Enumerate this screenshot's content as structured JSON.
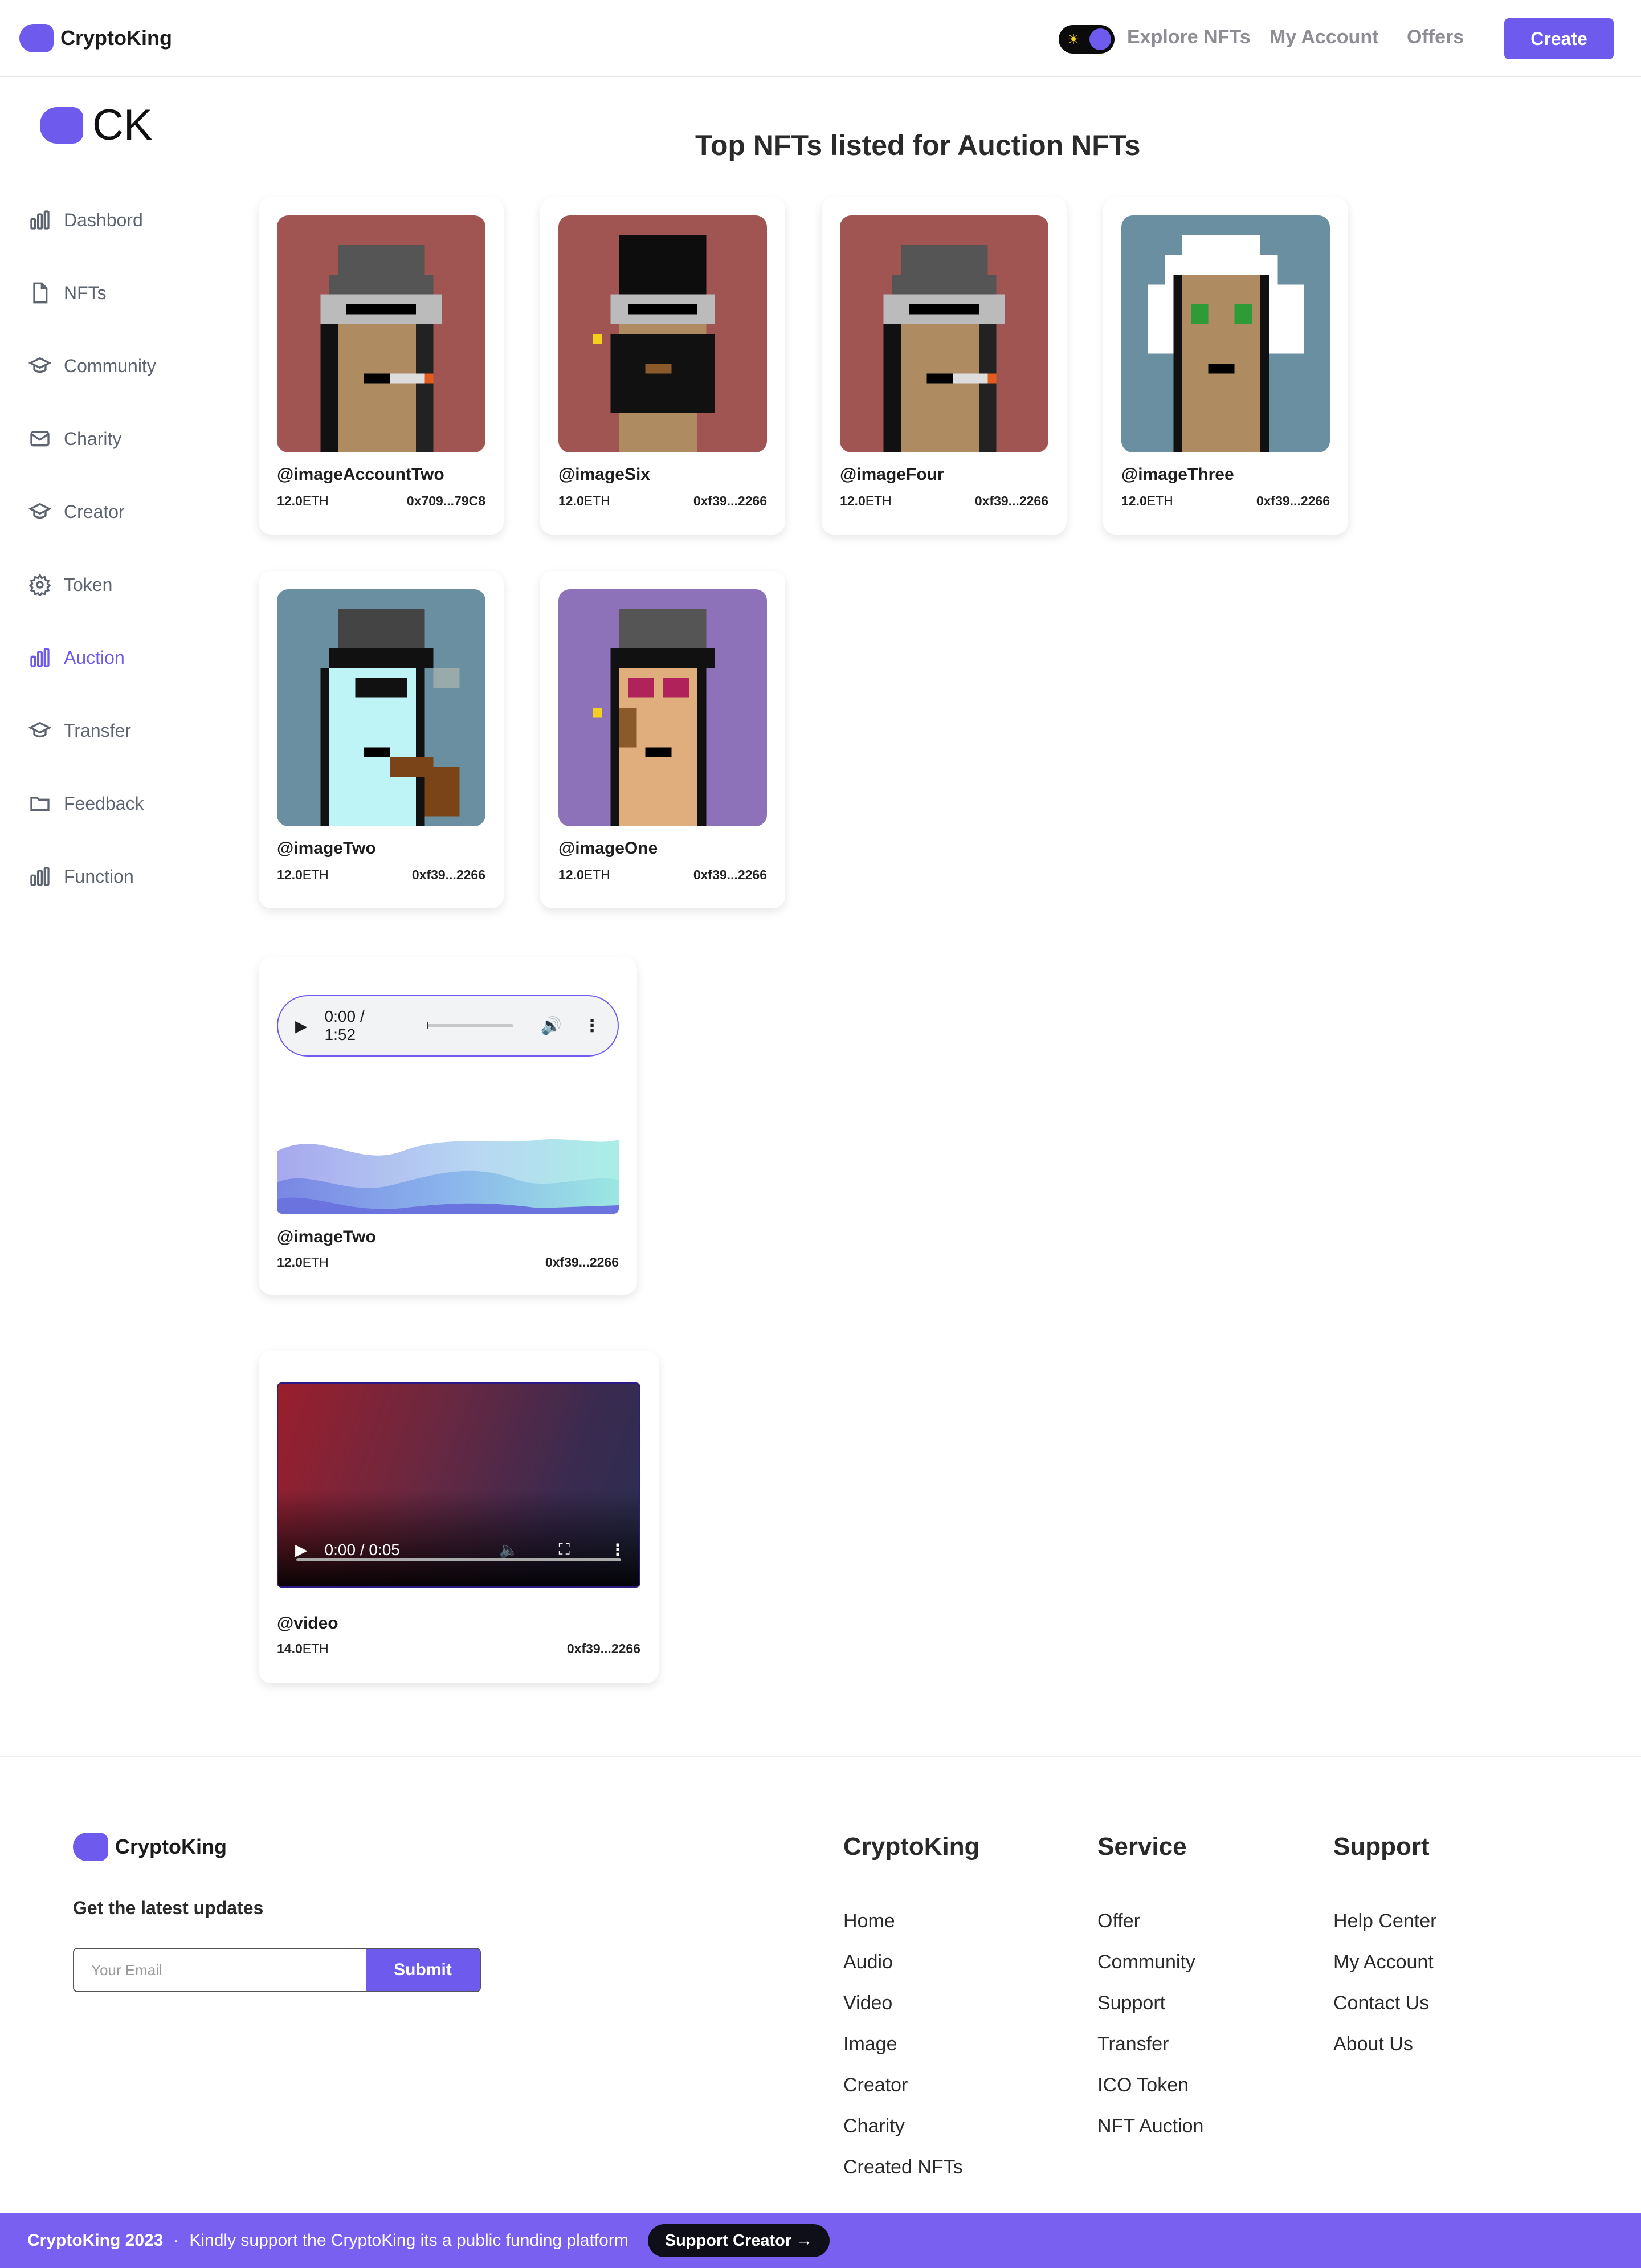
{
  "header": {
    "brand": "CryptoKing",
    "nav": [
      "Explore NFTs",
      "My Account",
      "Offers"
    ],
    "create_label": "Create"
  },
  "sidebar": {
    "logo_text": "CK",
    "items": [
      {
        "label": "Dashbord",
        "icon": "bar-chart-icon"
      },
      {
        "label": "NFTs",
        "icon": "file-icon"
      },
      {
        "label": "Community",
        "icon": "graduation-cap-icon"
      },
      {
        "label": "Charity",
        "icon": "mail-icon"
      },
      {
        "label": "Creator",
        "icon": "graduation-cap-icon"
      },
      {
        "label": "Token",
        "icon": "gear-icon"
      },
      {
        "label": "Auction",
        "icon": "bar-chart-icon"
      },
      {
        "label": "Transfer",
        "icon": "graduation-cap-icon"
      },
      {
        "label": "Feedback",
        "icon": "folder-icon"
      },
      {
        "label": "Function",
        "icon": "bar-chart-icon"
      }
    ],
    "active": "Auction",
    "accent": "#6e5bee"
  },
  "main": {
    "title": "Top NFTs listed for Auction NFTs",
    "image_cards": [
      {
        "name": "@imageAccountTwo",
        "price": "12.0",
        "unit": "ETH",
        "address": "0x709...79C8",
        "bg": "#a05552"
      },
      {
        "name": "@imageSix",
        "price": "12.0",
        "unit": "ETH",
        "address": "0xf39...2266",
        "bg": "#a05552"
      },
      {
        "name": "@imageFour",
        "price": "12.0",
        "unit": "ETH",
        "address": "0xf39...2266",
        "bg": "#a05552"
      },
      {
        "name": "@imageThree",
        "price": "12.0",
        "unit": "ETH",
        "address": "0xf39...2266",
        "bg": "#6a8fa0"
      },
      {
        "name": "@imageTwo",
        "price": "12.0",
        "unit": "ETH",
        "address": "0xf39...2266",
        "bg": "#6a8fa0"
      },
      {
        "name": "@imageOne",
        "price": "12.0",
        "unit": "ETH",
        "address": "0xf39...2266",
        "bg": "#8d72b9"
      }
    ],
    "audio_card": {
      "time": "0:00 / 1:52",
      "name": "@imageTwo",
      "price": "12.0",
      "unit": "ETH",
      "address": "0xf39...2266"
    },
    "video_card": {
      "time": "0:00 / 0:05",
      "name": "@video",
      "price": "14.0",
      "unit": "ETH",
      "address": "0xf39...2266"
    }
  },
  "footer": {
    "brand": "CryptoKing",
    "updates_label": "Get the latest updates",
    "email_placeholder": "Your Email",
    "submit_label": "Submit",
    "columns": [
      {
        "title": "CryptoKing",
        "links": [
          "Home",
          "Audio",
          "Video",
          "Image",
          "Creator",
          "Charity",
          "Created NFTs"
        ]
      },
      {
        "title": "Service",
        "links": [
          "Offer",
          "Community",
          "Support",
          "Transfer",
          "ICO Token",
          "NFT Auction"
        ]
      },
      {
        "title": "Support",
        "links": [
          "Help Center",
          "My Account",
          "Contact Us",
          "About Us"
        ]
      }
    ],
    "bottom": {
      "brand": "CryptoKing 2023",
      "sep": "·",
      "message": "Kindly support the CryptoKing its a public funding platform",
      "button": "Support Creator →"
    }
  }
}
